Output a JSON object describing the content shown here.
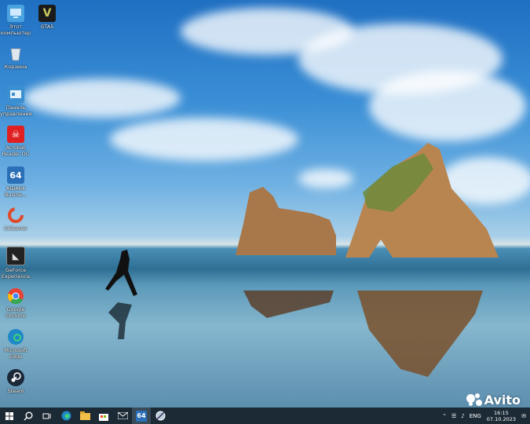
{
  "desktop_icons": [
    {
      "label": "Этот компьютер",
      "icon": "this-pc-icon"
    },
    {
      "label": "GTA5",
      "icon": "gta5-icon"
    },
    {
      "label": "Корзина",
      "icon": "recycle-bin-icon"
    },
    {
      "label": "Панель управления",
      "icon": "control-panel-icon"
    },
    {
      "label": "Acrobat Reader DC",
      "icon": "acrobat-reader-icon"
    },
    {
      "label": "AIDA64 Busine...",
      "icon": "aida64-icon"
    },
    {
      "label": "CCleaner",
      "icon": "ccleaner-icon"
    },
    {
      "label": "GeForce Experience",
      "icon": "geforce-experience-icon"
    },
    {
      "label": "Google Chrome",
      "icon": "chrome-icon"
    },
    {
      "label": "Microsoft Edge",
      "icon": "edge-icon"
    },
    {
      "label": "Steam",
      "icon": "steam-icon"
    }
  ],
  "taskbar": {
    "language": "ENG",
    "time": "16:15",
    "date": "07.10.2023"
  },
  "watermark": "Avito"
}
